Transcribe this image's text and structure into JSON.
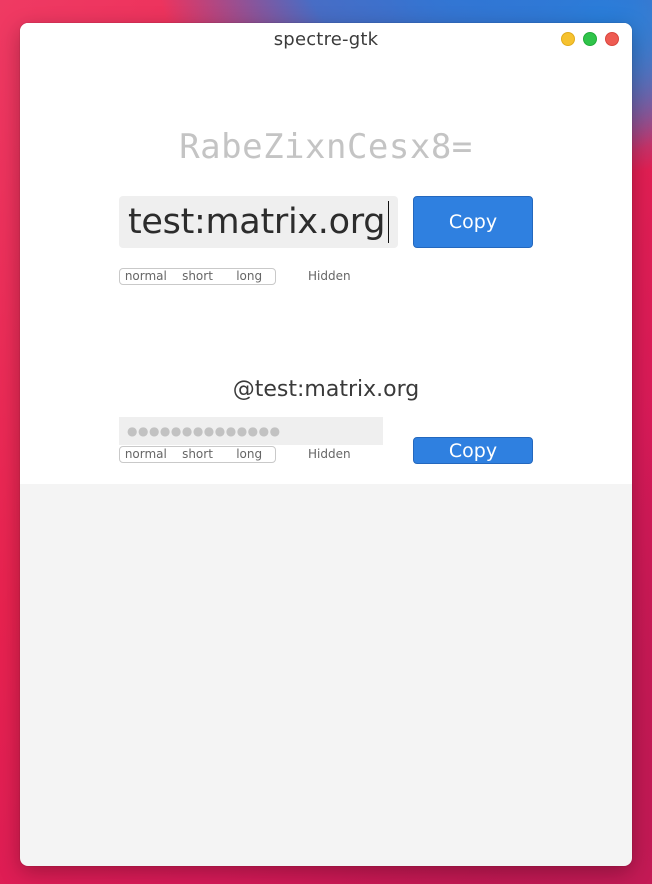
{
  "window": {
    "title": "spectre-gtk"
  },
  "generated_password": "RabeZixnCesx8=",
  "site": {
    "value": "test:matrix.org"
  },
  "copy_primary_label": "Copy",
  "copy_secondary_label": "Copy",
  "password_types": [
    "normal",
    "short",
    "long"
  ],
  "hidden_label": "Hidden",
  "login": {
    "name": "@test:matrix.org",
    "masked_value": "●●●●●●●●●●●●●●"
  },
  "colors": {
    "accent": "#2f80e0",
    "window_bg": "#ffffff",
    "lower_bg": "#f4f4f4",
    "close": "#ee5b52",
    "minimize": "#f6c22f",
    "maximize": "#2fc44a"
  }
}
